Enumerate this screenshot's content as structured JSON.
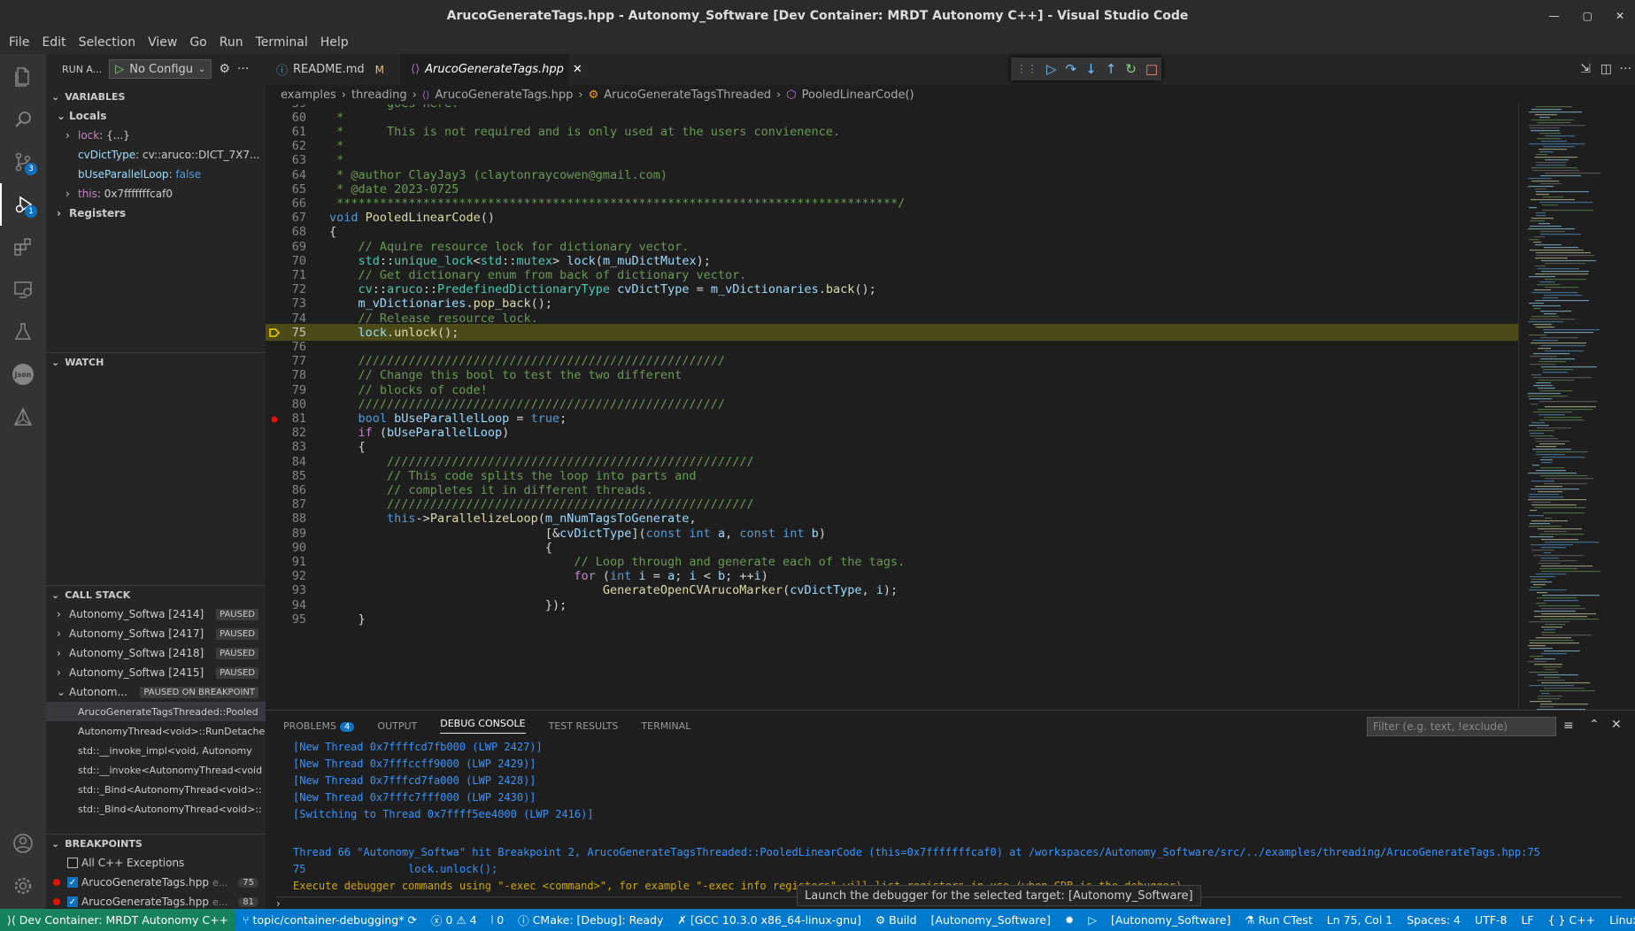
{
  "window": {
    "title": "ArucoGenerateTags.hpp - Autonomy_Software [Dev Container: MRDT Autonomy C++] - Visual Studio Code",
    "controls": [
      "✕",
      "▢",
      "—"
    ]
  },
  "menu": [
    "File",
    "Edit",
    "Selection",
    "View",
    "Go",
    "Run",
    "Terminal",
    "Help"
  ],
  "activity": {
    "source_control_badge": "3",
    "debug_badge": "1",
    "json_label": "Json"
  },
  "sidebar": {
    "run_label": "RUN A...",
    "config": "No Configu",
    "variables_header": "VARIABLES",
    "locals_header": "Locals",
    "locals": [
      {
        "name": "lock",
        "value": "{...}"
      },
      {
        "name": "cvDictType",
        "value": "cv::aruco::DICT_7X7..."
      },
      {
        "name": "bUseParallelLoop",
        "value": "false"
      },
      {
        "name": "this",
        "value": "0x7fffffffcaf0"
      }
    ],
    "registers_header": "Registers",
    "watch_header": "WATCH",
    "callstack_header": "CALL STACK",
    "threads": [
      {
        "name": "Autonomy_Softwa [2414]",
        "status": "PAUSED"
      },
      {
        "name": "Autonomy_Softwa [2417]",
        "status": "PAUSED"
      },
      {
        "name": "Autonomy_Softwa [2418]",
        "status": "PAUSED"
      },
      {
        "name": "Autonomy_Softwa [2415]",
        "status": "PAUSED"
      },
      {
        "name": "Autonom...",
        "status": "PAUSED ON BREAKPOINT"
      }
    ],
    "frames": [
      "ArucoGenerateTagsThreaded::Pooled",
      "AutonomyThread<void>::RunDetached",
      "std::__invoke_impl<void, Autonomy",
      "std::__invoke<AutonomyThread<void",
      "std::_Bind<AutonomyThread<void>::",
      "std::_Bind<AutonomyThread<void>::"
    ],
    "breakpoints_header": "BREAKPOINTS",
    "breakpoints": [
      {
        "label": "All C++ Exceptions",
        "checked": false,
        "line": ""
      },
      {
        "label": "ArucoGenerateTags.hpp",
        "suffix": "e...",
        "line": "75"
      },
      {
        "label": "ArucoGenerateTags.hpp",
        "suffix": "e...",
        "line": "81"
      }
    ]
  },
  "tabs": [
    {
      "label": "README.md",
      "mod": "M",
      "active": false
    },
    {
      "label": "ArucoGenerateTags.hpp",
      "mod": "✕",
      "active": true
    }
  ],
  "breadcrumb": [
    "examples",
    "threading",
    "ArucoGenerateTags.hpp",
    "ArucoGenerateTagsThreaded",
    "PooledLinearCode()"
  ],
  "editor": {
    "lines": [
      {
        "n": "59",
        "text": " *      goes here."
      },
      {
        "n": "60",
        "text": " *"
      },
      {
        "n": "61",
        "text": " *      This is not required and is only used at the users convienence."
      },
      {
        "n": "62",
        "text": " *"
      },
      {
        "n": "63",
        "text": " *"
      },
      {
        "n": "64",
        "text": " * @author ClayJay3 (claytonraycowen@gmail.com)"
      },
      {
        "n": "65",
        "text": " * @date 2023-0725"
      },
      {
        "n": "66",
        "text": " ******************************************************************************/"
      },
      {
        "n": "67",
        "text": "void PooledLinearCode()"
      },
      {
        "n": "68",
        "text": "{"
      },
      {
        "n": "69",
        "text": "    // Aquire resource lock for dictionary vector."
      },
      {
        "n": "70",
        "text": "    std::unique_lock<std::mutex> lock(m_muDictMutex);"
      },
      {
        "n": "71",
        "text": "    // Get dictionary enum from back of dictionary vector."
      },
      {
        "n": "72",
        "text": "    cv::aruco::PredefinedDictionaryType cvDictType = m_vDictionaries.back();"
      },
      {
        "n": "73",
        "text": "    m_vDictionaries.pop_back();"
      },
      {
        "n": "74",
        "text": "    // Release resource lock."
      },
      {
        "n": "75",
        "text": "    lock.unlock();"
      },
      {
        "n": "76",
        "text": ""
      },
      {
        "n": "77",
        "text": "    ///////////////////////////////////////////////////"
      },
      {
        "n": "78",
        "text": "    // Change this bool to test the two different"
      },
      {
        "n": "79",
        "text": "    // blocks of code!"
      },
      {
        "n": "80",
        "text": "    ///////////////////////////////////////////////////"
      },
      {
        "n": "81",
        "text": "    bool bUseParallelLoop = true;"
      },
      {
        "n": "82",
        "text": "    if (bUseParallelLoop)"
      },
      {
        "n": "83",
        "text": "    {"
      },
      {
        "n": "84",
        "text": "        ///////////////////////////////////////////////////"
      },
      {
        "n": "85",
        "text": "        // This code splits the loop into parts and"
      },
      {
        "n": "86",
        "text": "        // completes it in different threads."
      },
      {
        "n": "87",
        "text": "        ///////////////////////////////////////////////////"
      },
      {
        "n": "88",
        "text": "        this->ParallelizeLoop(m_nNumTagsToGenerate,"
      },
      {
        "n": "89",
        "text": "                              [&cvDictType](const int a, const int b)"
      },
      {
        "n": "90",
        "text": "                              {"
      },
      {
        "n": "91",
        "text": "                                  // Loop through and generate each of the tags."
      },
      {
        "n": "92",
        "text": "                                  for (int i = a; i < b; ++i)"
      },
      {
        "n": "93",
        "text": "                                      GenerateOpenCVArucoMarker(cvDictType, i);"
      },
      {
        "n": "94",
        "text": "                              });"
      },
      {
        "n": "95",
        "text": "    }"
      }
    ]
  },
  "panel": {
    "tabs": [
      "PROBLEMS",
      "OUTPUT",
      "DEBUG CONSOLE",
      "TEST RESULTS",
      "TERMINAL"
    ],
    "problems_count": "4",
    "filter_placeholder": "Filter (e.g. text, !exclude)",
    "lines": [
      "[New Thread 0x7ffffcd7fb000 (LWP 2427)]",
      "[New Thread 0x7fffccff9000 (LWP 2429)]",
      "[New Thread 0x7fffcd7fa000 (LWP 2428)]",
      "[New Thread 0x7fffc7fff000 (LWP 2430)]",
      "[Switching to Thread 0x7ffff5ee4000 (LWP 2416)]",
      "",
      "Thread 66 \"Autonomy_Softwa\" hit Breakpoint 2, ArucoGenerateTagsThreaded::PooledLinearCode (this=0x7fffffffcaf0) at /workspaces/Autonomy_Software/src/../examples/threading/ArucoGenerateTags.hpp:75",
      "75                lock.unlock();",
      "Execute debugger commands using \"-exec <command>\", for example \"-exec info registers\" will list registers in use (when GDB is the debugger)"
    ]
  },
  "tooltip": "Launch the debugger for the selected target: [Autonomy_Software]",
  "status": {
    "remote": "Dev Container: MRDT Autonomy C++",
    "branch": "topic/container-debugging*",
    "errors": "0",
    "warnings": "4",
    "ports": "0",
    "cmake": "CMake: [Debug]: Ready",
    "kit": "[GCC 10.3.0 x86_64-linux-gnu]",
    "build": "Build",
    "target1": "[Autonomy_Software]",
    "target2": "[Autonomy_Software]",
    "ctest": "Run CTest",
    "position": "Ln 75, Col 1",
    "spaces": "Spaces: 4",
    "encoding": "UTF-8",
    "eol": "LF",
    "lang": "C++",
    "os": "Linux"
  },
  "colors": {
    "statusbar": "#007acc",
    "highlight": "#4b4b18",
    "breakpoint": "#e51400"
  }
}
